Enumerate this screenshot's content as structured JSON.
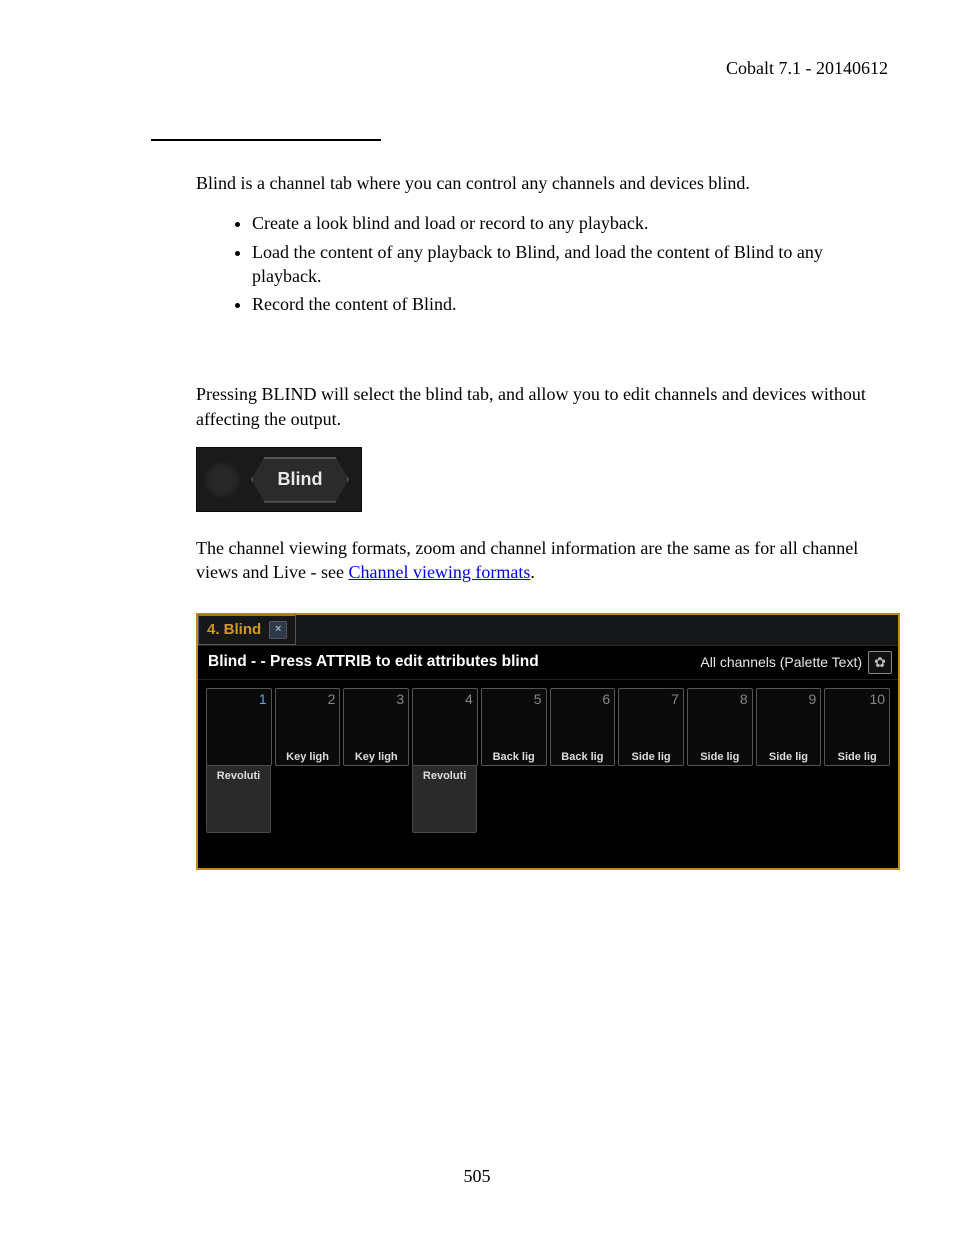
{
  "header": {
    "right": "Cobalt 7.1 - 20140612"
  },
  "intro": "Blind is a channel tab where you can control any channels and devices blind.",
  "bullets": [
    "Create a look blind and load or record to any playback.",
    "Load the content of any playback to Blind, and load the content of Blind to any playback.",
    "Record the content of Blind."
  ],
  "para2": "Pressing BLIND will select the blind tab, and allow you to edit channels and devices without affecting the output.",
  "blind_btn_label": "Blind",
  "para3_prefix": "The channel viewing formats, zoom and channel information are the same as for all channel views and Live - see ",
  "para3_link": "Channel viewing formats",
  "para3_suffix": ".",
  "ui": {
    "tab_label": "4. Blind",
    "header_left": "Blind -  - Press ATTRIB to edit attributes blind",
    "header_right": "All channels (Palette Text)",
    "channels": [
      {
        "n": "1",
        "label": "",
        "extra": "Revoluti",
        "active": true
      },
      {
        "n": "2",
        "label": "Key ligh",
        "extra": "",
        "active": false
      },
      {
        "n": "3",
        "label": "Key ligh",
        "extra": "",
        "active": false
      },
      {
        "n": "4",
        "label": "",
        "extra": "Revoluti",
        "active": false
      },
      {
        "n": "5",
        "label": "Back lig",
        "extra": "",
        "active": false
      },
      {
        "n": "6",
        "label": "Back lig",
        "extra": "",
        "active": false
      },
      {
        "n": "7",
        "label": "Side lig",
        "extra": "",
        "active": false
      },
      {
        "n": "8",
        "label": "Side lig",
        "extra": "",
        "active": false
      },
      {
        "n": "9",
        "label": "Side lig",
        "extra": "",
        "active": false
      },
      {
        "n": "10",
        "label": "Side lig",
        "extra": "",
        "active": false
      }
    ]
  },
  "page_number": "505"
}
